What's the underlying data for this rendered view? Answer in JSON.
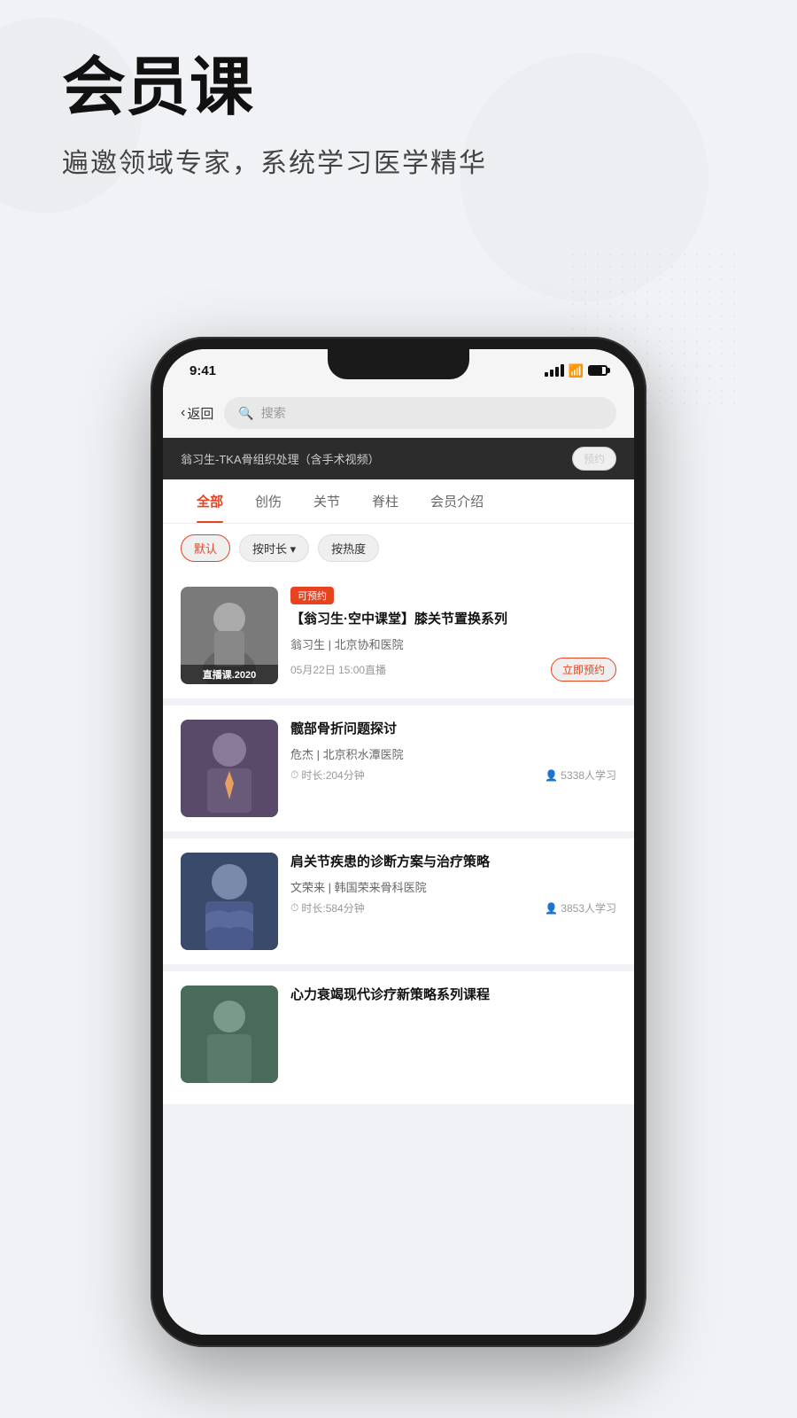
{
  "hero": {
    "title": "会员课",
    "subtitle": "遍邀领域专家，系统学习医学精华"
  },
  "status_bar": {
    "time": "9:41",
    "signal": "signal",
    "wifi": "wifi",
    "battery": "battery"
  },
  "nav": {
    "back_label": "返回",
    "search_placeholder": "搜索"
  },
  "sticky_header": {
    "title": "翁习生-TKA骨组织处理（含手术视频）",
    "reserve_label": "预约"
  },
  "tabs": [
    {
      "label": "全部",
      "active": true
    },
    {
      "label": "创伤",
      "active": false
    },
    {
      "label": "关节",
      "active": false
    },
    {
      "label": "脊柱",
      "active": false
    },
    {
      "label": "会员介绍",
      "active": false
    }
  ],
  "filters": [
    {
      "label": "默认",
      "active": true
    },
    {
      "label": "按时长 ▾",
      "active": false
    },
    {
      "label": "按热度",
      "active": false
    }
  ],
  "courses": [
    {
      "id": 1,
      "tag": "可预约",
      "title": "【翁习生·空中课堂】膝关节置换系列",
      "doctor": "翁习生 | 北京协和医院",
      "live_time": "05月22日 15:00直播",
      "live_label": "直播课.2020",
      "book_label": "立即预约",
      "is_live": true
    },
    {
      "id": 2,
      "tag": "",
      "title": "髋部骨折问题探讨",
      "doctor": "危杰 | 北京积水潭医院",
      "duration": "时长:204分钟",
      "students": "5338人学习",
      "is_live": false
    },
    {
      "id": 3,
      "tag": "",
      "title": "肩关节疾患的诊断方案与治疗策略",
      "doctor": "文荣来 | 韩国荣来骨科医院",
      "duration": "时长:584分钟",
      "students": "3853人学习",
      "is_live": false
    },
    {
      "id": 4,
      "tag": "",
      "title": "心力衰竭现代诊疗新策略系列课程",
      "doctor": "",
      "duration": "",
      "students": "",
      "is_live": false,
      "partial": true
    }
  ]
}
